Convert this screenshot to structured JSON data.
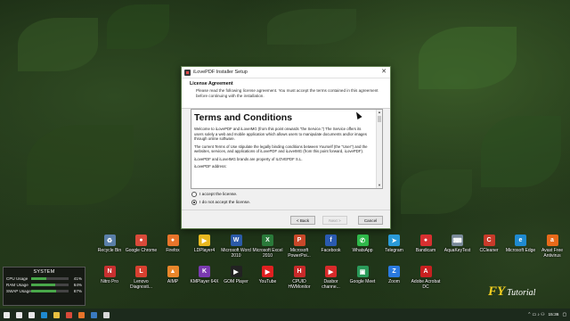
{
  "dialog": {
    "title": "iLovePDF Installer Setup",
    "close_glyph": "✕",
    "header_title": "License Agreement",
    "header_desc": "Please read the following license agreement. You must accept the terms contained in this agreement before continuing with the installation.",
    "license_heading": "Terms and Conditions",
    "license_paragraphs": [
      "Welcome to iLovePDF and iLoveIMG (from this point onwards \"the Service.\") The Service offers its users solely a web and mobile application which allows users to manipulate documents and/or images through online software.",
      "The current Terms of Use stipulate the legally binding conditions between Yourself (the \"User\") and the websites, services, and applications of iLovePDF and iLoveIMG (from this point forward, iLovePDF).",
      "iLovePDF and iLoveIMG brands are property of ILOVEPDF S.L.",
      "iLovePDF address:"
    ],
    "radio_accept": "I accept the license.",
    "radio_decline": "I do not accept the license.",
    "selected_radio": "decline",
    "btn_back": "< Back",
    "btn_next": "Next >",
    "btn_cancel": "Cancel"
  },
  "desktop_icons_row1": [
    {
      "label": "Recycle Bin",
      "icon": "recycle-bin-icon",
      "color": "#5a7fa8",
      "glyph": "♻"
    },
    {
      "label": "Google Chrome",
      "icon": "chrome-icon",
      "color": "#d94a3a",
      "glyph": "●"
    },
    {
      "label": "Firefox",
      "icon": "firefox-icon",
      "color": "#e8742a",
      "glyph": "●"
    },
    {
      "label": "LDPlayer4",
      "icon": "ldplayer-icon",
      "color": "#e8b820",
      "glyph": "▶"
    },
    {
      "label": "Microsoft Word 2010",
      "icon": "word-icon",
      "color": "#2b5aa8",
      "glyph": "W"
    },
    {
      "label": "Microsoft Excel 2010",
      "icon": "excel-icon",
      "color": "#2a7a3a",
      "glyph": "X"
    },
    {
      "label": "Microsoft PowerPoi...",
      "icon": "powerpoint-icon",
      "color": "#c8482a",
      "glyph": "P"
    },
    {
      "label": "Facebook",
      "icon": "facebook-icon",
      "color": "#2a5ab0",
      "glyph": "f"
    },
    {
      "label": "WhatsApp",
      "icon": "whatsapp-icon",
      "color": "#2fb84a",
      "glyph": "✆"
    },
    {
      "label": "Telegram",
      "icon": "telegram-icon",
      "color": "#2a9ad8",
      "glyph": "➤"
    },
    {
      "label": "Bandicam",
      "icon": "bandicam-icon",
      "color": "#d83030",
      "glyph": "●"
    },
    {
      "label": "AquaKeyTest",
      "icon": "aquakeytest-icon",
      "color": "#7a8a9a",
      "glyph": "⌨"
    },
    {
      "label": "CCleaner",
      "icon": "ccleaner-icon",
      "color": "#c83a2a",
      "glyph": "C"
    },
    {
      "label": "Microsoft Edge",
      "icon": "edge-icon",
      "color": "#1f8ad0",
      "glyph": "e"
    },
    {
      "label": "Avast Free Antivirus",
      "icon": "avast-icon",
      "color": "#e86a1a",
      "glyph": "a"
    }
  ],
  "desktop_icons_row2": [
    {
      "label": "Nitro Pro",
      "icon": "nitro-icon",
      "color": "#c83030",
      "glyph": "N"
    },
    {
      "label": "Lenovo Diagnosti...",
      "icon": "lenovo-icon",
      "color": "#d84030",
      "glyph": "L"
    },
    {
      "label": "AIMP",
      "icon": "aimp-icon",
      "color": "#e8862a",
      "glyph": "▲"
    },
    {
      "label": "KMPlayer 64X",
      "icon": "kmplayer-icon",
      "color": "#7a3ab0",
      "glyph": "K"
    },
    {
      "label": "GOM Player",
      "icon": "gom-icon",
      "color": "#222222",
      "glyph": "▶"
    },
    {
      "label": "YouTube",
      "icon": "youtube-icon",
      "color": "#e02020",
      "glyph": "▶"
    },
    {
      "label": "CPUID HWMonitor",
      "icon": "hwmonitor-icon",
      "color": "#c82a2a",
      "glyph": "H"
    },
    {
      "label": "Dasbor channe...",
      "icon": "dasbor-icon",
      "color": "#d82a2a",
      "glyph": "▶"
    },
    {
      "label": "Google Meet",
      "icon": "meet-icon",
      "color": "#2a9a5a",
      "glyph": "▣"
    },
    {
      "label": "Zoom",
      "icon": "zoom-icon",
      "color": "#2a7ae0",
      "glyph": "Z"
    },
    {
      "label": "Adobe Acrobat DC",
      "icon": "acrobat-icon",
      "color": "#c82020",
      "glyph": "A"
    }
  ],
  "system": {
    "title": "SYSTEM",
    "rows": [
      {
        "name": "CPU Usage",
        "value": "41%",
        "fill": 0.41
      },
      {
        "name": "RAM Usage",
        "value": "64%",
        "fill": 0.64
      },
      {
        "name": "SWAP Usage",
        "value": "67%",
        "fill": 0.67
      }
    ]
  },
  "watermark": {
    "fy": "FY",
    "tutorial": "Tutorial"
  },
  "taskbar": {
    "items": [
      {
        "icon": "windows-start-icon",
        "color": "#e8e8e8"
      },
      {
        "icon": "search-icon",
        "color": "#e8e8e8"
      },
      {
        "icon": "task-view-icon",
        "color": "#e8e8e8"
      },
      {
        "icon": "edge-taskbar-icon",
        "color": "#1f8ad0"
      },
      {
        "icon": "file-explorer-icon",
        "color": "#e8c040"
      },
      {
        "icon": "chrome-taskbar-icon",
        "color": "#d94a3a"
      },
      {
        "icon": "firefox-taskbar-icon",
        "color": "#e8742a"
      },
      {
        "icon": "app-taskbar-icon",
        "color": "#3a7ac0"
      },
      {
        "icon": "installer-taskbar-icon",
        "color": "#d8d8d8"
      }
    ],
    "time": "15:36"
  }
}
